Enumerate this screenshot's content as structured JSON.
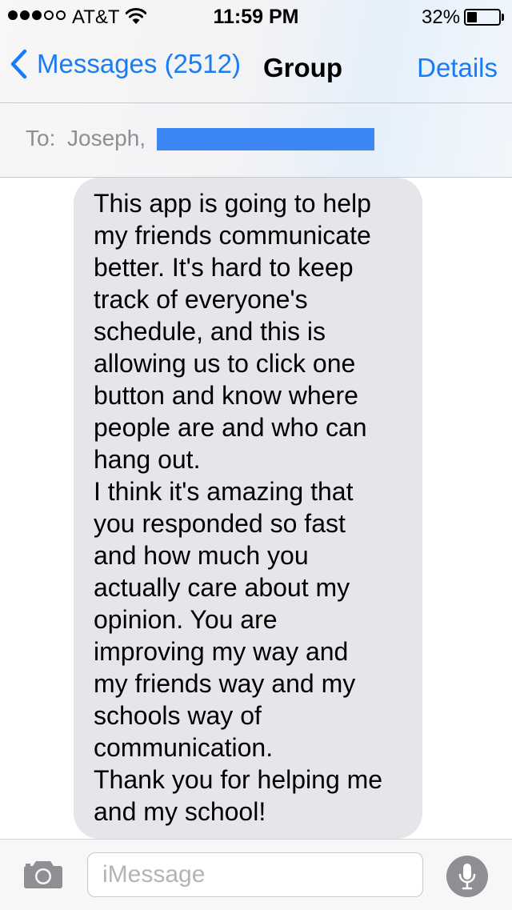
{
  "status_bar": {
    "signal_dots": {
      "filled": 3,
      "total": 5
    },
    "carrier": "AT&T",
    "wifi_icon": "wifi-icon",
    "time": "11:59 PM",
    "battery_percent": "32%",
    "battery_level": 0.32
  },
  "nav": {
    "back_icon": "chevron-left-icon",
    "back_label": "Messages (2512)",
    "title": "Group",
    "details_label": "Details",
    "accent_color": "#1a7cf2"
  },
  "recipients": {
    "to_label": "To:",
    "visible_name": "Joseph,",
    "redaction_color": "#3d87f5"
  },
  "message": {
    "bubble_color": "#e5e5ea",
    "lines": [
      "This app is going to help",
      "my friends communicate",
      "better. It's hard to keep",
      "track of everyone's",
      "schedule, and this is",
      "allowing us to click one",
      "button and know where",
      "people are and who can",
      "hang out.",
      "I think it's amazing that",
      "you responded so fast",
      "and how much you",
      "actually care about my",
      "opinion. You are",
      "improving my way and",
      "my friends way and my",
      "schools way of",
      "communication.",
      "Thank you for helping me",
      "and my school!"
    ]
  },
  "compose": {
    "camera_icon": "camera-icon",
    "placeholder": "iMessage",
    "value": "",
    "mic_icon": "microphone-icon"
  }
}
